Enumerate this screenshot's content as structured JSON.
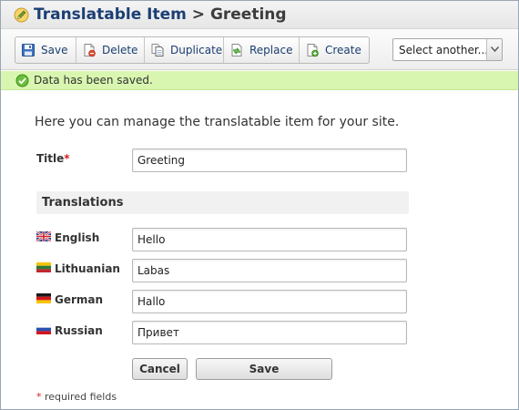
{
  "header": {
    "title": "Translatable Item",
    "separator": ">",
    "subtitle": "Greeting",
    "logo_icon": "pencil-circle-icon"
  },
  "toolbar": {
    "buttons": [
      {
        "label": "Save",
        "icon": "floppy-disk-icon"
      },
      {
        "label": "Delete",
        "icon": "page-delete-icon"
      },
      {
        "label": "Duplicate",
        "icon": "page-copy-icon"
      },
      {
        "label": "Replace",
        "icon": "page-replace-icon"
      },
      {
        "label": "Create",
        "icon": "page-add-icon"
      }
    ],
    "select": {
      "value": "Select another..."
    }
  },
  "status": {
    "message": "Data has been saved.",
    "icon": "check-circle-icon",
    "color": "#d9f6b0"
  },
  "form": {
    "intro": "Here you can manage the translatable item for your site.",
    "title_label": "Title",
    "required_mark": "*",
    "title_value": "Greeting",
    "translations_heading": "Translations",
    "translations": [
      {
        "language": "English",
        "flag": "uk-flag-icon",
        "value": "Hello"
      },
      {
        "language": "Lithuanian",
        "flag": "lithuania-flag-icon",
        "value": "Labas"
      },
      {
        "language": "German",
        "flag": "germany-flag-icon",
        "value": "Hallo"
      },
      {
        "language": "Russian",
        "flag": "russia-flag-icon",
        "value": "Привет"
      }
    ],
    "cancel_label": "Cancel",
    "save_label": "Save",
    "footnote": "required fields"
  },
  "colors": {
    "title": "#1b3f74",
    "accent_text": "#1a3e70",
    "required": "#d32020"
  }
}
